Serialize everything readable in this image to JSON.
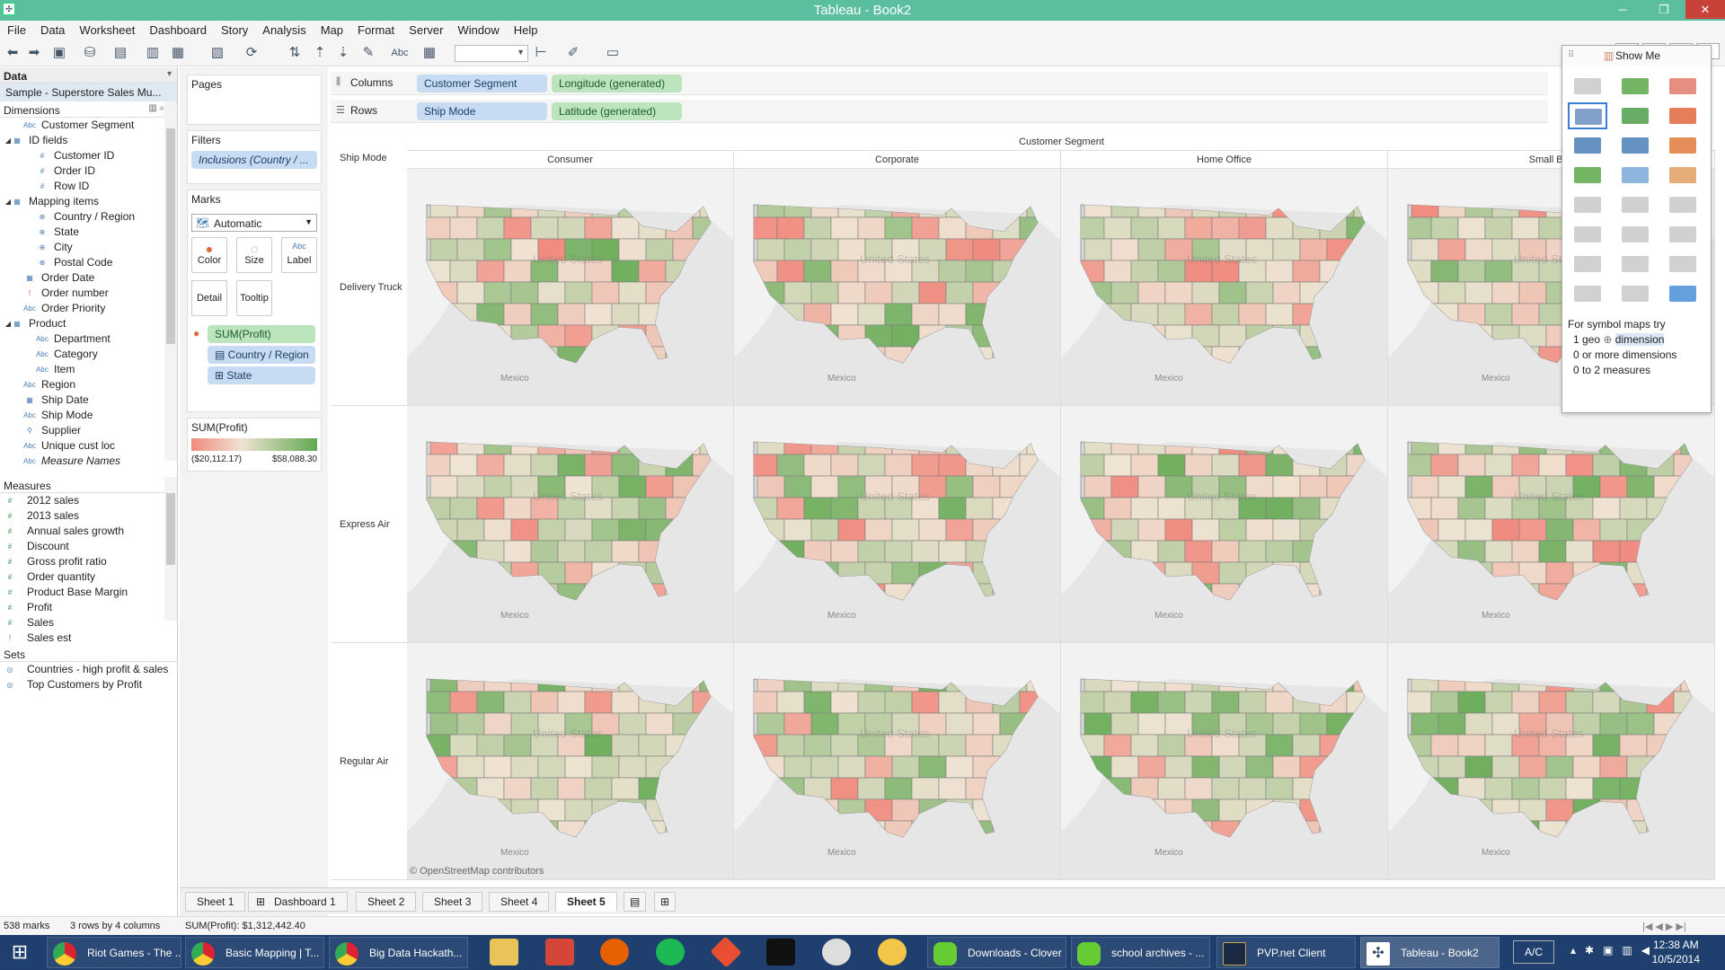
{
  "window": {
    "title": "Tableau - Book2"
  },
  "menu": [
    "File",
    "Data",
    "Worksheet",
    "Dashboard",
    "Story",
    "Analysis",
    "Map",
    "Format",
    "Server",
    "Window",
    "Help"
  ],
  "data_pane": {
    "header": "Data",
    "datasource": "Sample - Superstore Sales Mu...",
    "dimensions_header": "Dimensions",
    "dimensions": [
      {
        "label": "Customer Segment",
        "icon": "Abc",
        "indent": 0
      },
      {
        "label": "ID fields",
        "icon": "folder-icon",
        "indent": 0
      },
      {
        "label": "Customer ID",
        "icon": "#",
        "indent": 1
      },
      {
        "label": "Order ID",
        "icon": "#",
        "indent": 1
      },
      {
        "label": "Row ID",
        "icon": "#",
        "indent": 1
      },
      {
        "label": "Mapping items",
        "icon": "folder-icon",
        "indent": 0
      },
      {
        "label": "Country / Region",
        "icon": "globe-icon",
        "indent": 1
      },
      {
        "label": "State",
        "icon": "globe-icon",
        "indent": 1
      },
      {
        "label": "City",
        "icon": "globe-icon",
        "indent": 1
      },
      {
        "label": "Postal Code",
        "icon": "globe-icon",
        "indent": 1
      },
      {
        "label": "Order Date",
        "icon": "calendar-icon",
        "indent": 0
      },
      {
        "label": "Order number",
        "icon": "!",
        "indent": 0
      },
      {
        "label": "Order Priority",
        "icon": "Abc",
        "indent": 0
      },
      {
        "label": "Product",
        "icon": "folder-icon",
        "indent": 0
      },
      {
        "label": "Department",
        "icon": "Abc",
        "indent": 1
      },
      {
        "label": "Category",
        "icon": "Abc",
        "indent": 1
      },
      {
        "label": "Item",
        "icon": "Abc",
        "indent": 1
      },
      {
        "label": "Region",
        "icon": "Abc",
        "indent": 0
      },
      {
        "label": "Ship Date",
        "icon": "calendar-icon",
        "indent": 0
      },
      {
        "label": "Ship Mode",
        "icon": "Abc",
        "indent": 0
      },
      {
        "label": "Supplier",
        "icon": "link-icon",
        "indent": 0
      },
      {
        "label": "Unique cust loc",
        "icon": "Abc",
        "indent": 0
      },
      {
        "label": "Measure Names",
        "icon": "Abc",
        "indent": 0
      }
    ],
    "measures_header": "Measures",
    "measures": [
      "2012 sales",
      "2013 sales",
      "Annual sales growth",
      "Discount",
      "Gross profit ratio",
      "Order quantity",
      "Product Base Margin",
      "Profit",
      "Sales",
      "Sales est"
    ],
    "sets_header": "Sets",
    "sets": [
      "Countries - high profit & sales",
      "Top Customers by Profit"
    ]
  },
  "shelves": {
    "pages": "Pages",
    "filters": "Filters",
    "filter_pill": "Inclusions (Country / ...",
    "marks": "Marks",
    "mark_type": "Automatic",
    "mark_buttons": {
      "color": "Color",
      "size": "Size",
      "label": "Label",
      "detail": "Detail",
      "tooltip": "Tooltip"
    },
    "mark_pills": [
      "SUM(Profit)",
      "Country / Region",
      "State"
    ],
    "legend_title": "SUM(Profit)",
    "legend_min": "($20,112.17)",
    "legend_max": "$58,088.30",
    "columns_label": "Columns",
    "rows_label": "Rows",
    "columns_pills": [
      "Customer Segment",
      "Longitude (generated)"
    ],
    "rows_pills": [
      "Ship Mode",
      "Latitude (generated)"
    ]
  },
  "view": {
    "column_title": "Customer Segment",
    "row_title": "Ship Mode",
    "columns": [
      "Consumer",
      "Corporate",
      "Home Office",
      "Small Bus"
    ],
    "rows": [
      "Delivery Truck",
      "Express Air",
      "Regular Air"
    ],
    "map_watermark": "United States",
    "map_label_mexico": "Mexico",
    "attribution": "© OpenStreetMap contributors",
    "colors": {
      "low": "#f08a7e",
      "mid": "#efe3d3",
      "high": "#5fa84f"
    }
  },
  "show_me": {
    "title": "Show Me",
    "hint_line1": "For symbol maps try",
    "hint_line2": "1 geo",
    "hint_line2b": "dimension",
    "hint_line3": "0 or more dimensions",
    "hint_line4": "0 to 2 measures"
  },
  "sheet_tabs": [
    "Sheet 1",
    "Dashboard 1",
    "Sheet 2",
    "Sheet 3",
    "Sheet 4",
    "Sheet 5"
  ],
  "active_tab": "Sheet 5",
  "status": {
    "marks": "538 marks",
    "grid": "3 rows by 4 columns",
    "sum": "SUM(Profit): $1,312,442.40"
  },
  "taskbar": {
    "items": [
      "Riot Games - The ...",
      "Basic Mapping | T...",
      "Big Data Hackath...",
      "Downloads - Clover",
      "school archives - ...",
      "PVP.net Client",
      "Tableau - Book2"
    ],
    "input": "A/C",
    "time": "12:38 AM",
    "date": "10/5/2014"
  }
}
